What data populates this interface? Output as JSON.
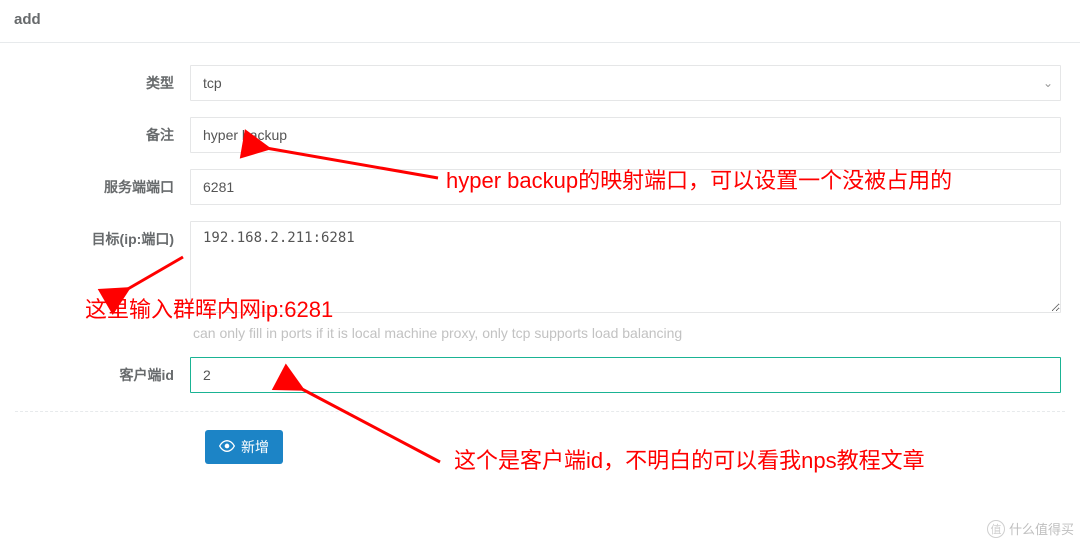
{
  "page": {
    "title": "add"
  },
  "form": {
    "type": {
      "label": "类型",
      "value": "tcp"
    },
    "remark": {
      "label": "备注",
      "value": "hyper backup"
    },
    "server_port": {
      "label": "服务端端口",
      "value": "6281"
    },
    "target": {
      "label": "目标(ip:端口)",
      "value": "192.168.2.211:6281",
      "help": "can only fill in ports if it is local machine proxy, only tcp supports load balancing"
    },
    "client_id": {
      "label": "客户端id",
      "value": "2"
    }
  },
  "button": {
    "add": "新增"
  },
  "annotations": {
    "a1": "hyper backup的映射端口，可以设置一个没被占用的",
    "a2": "这里输入群晖内网ip:6281",
    "a3": "这个是客户端id，不明白的可以看我nps教程文章"
  },
  "watermark": "什么值得买"
}
